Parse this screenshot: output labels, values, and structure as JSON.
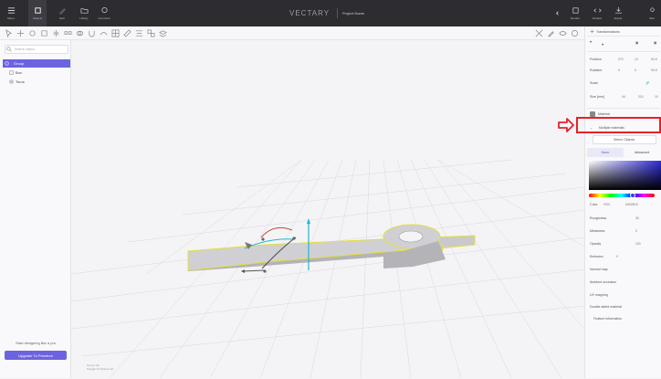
{
  "topbar": {
    "left_items": [
      {
        "label": "Menu",
        "icon": "hamburger-icon"
      },
      {
        "label": "Objects",
        "icon": "cube-icon"
      },
      {
        "label": "Edit",
        "icon": "pen-icon"
      },
      {
        "label": "Library",
        "icon": "folder-icon"
      },
      {
        "label": "Comment",
        "icon": "comment-icon"
      }
    ],
    "brand": "VECTARY",
    "project": "Project Name",
    "right_items": [
      {
        "label": "Render",
        "icon": "render-icon"
      },
      {
        "label": "Embed",
        "icon": "code-icon"
      },
      {
        "label": "Export",
        "icon": "export-icon"
      },
      {
        "label": "Sha",
        "icon": "share-icon"
      }
    ]
  },
  "search": {
    "placeholder": "Search object..."
  },
  "tree": [
    {
      "label": "Group",
      "selected": true
    },
    {
      "label": "Box",
      "selected": false
    },
    {
      "label": "Torus",
      "selected": false
    }
  ],
  "upgrade": {
    "text": "Start designing like a pro",
    "button": "Upgrade To Premium"
  },
  "status": {
    "line1": "Group info",
    "line2": "Polygon   8 Vertices   30"
  },
  "panel": {
    "title": "Transformations",
    "rows": [
      {
        "label": "Position",
        "values": [
          "270",
          "12",
          "63.5"
        ]
      },
      {
        "label": "Rotation",
        "values": [
          "0",
          "0",
          "90.8"
        ]
      },
      {
        "label": "Scale",
        "values": []
      },
      {
        "label": "Size [mm]",
        "values": [
          "44",
          "210",
          "10"
        ]
      }
    ],
    "material": "Material",
    "multiple": "Multiple materials",
    "select_objects": "Select Objects",
    "tabs": [
      "Basic",
      "Advanced"
    ],
    "color_label": "Color",
    "color_mode": "HSV",
    "color_value": "#3025D0",
    "props": [
      {
        "label": "Roughness",
        "value": "30"
      },
      {
        "label": "Metalness",
        "value": "0"
      },
      {
        "label": "Opacity",
        "value": "100"
      },
      {
        "label": "Emission",
        "value": "0"
      },
      {
        "label": "Normal map",
        "value": ""
      },
      {
        "label": "Ambient occlusion",
        "value": ""
      },
      {
        "label": "UV mapping",
        "value": ""
      }
    ],
    "double_sided": "Double-sided material",
    "features": "Feature information"
  },
  "accent": "#6c63e0",
  "highlight": "#e8202a"
}
